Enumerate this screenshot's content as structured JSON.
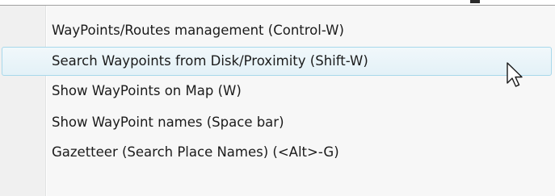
{
  "menu": {
    "items": [
      {
        "label": "WayPoints/Routes management (Control-W)"
      },
      {
        "label": "Search Waypoints from Disk/Proximity (Shift-W)"
      },
      {
        "label": "Show WayPoints on Map (W)"
      },
      {
        "label": "Show WayPoint names (Space bar)"
      },
      {
        "label": "Gazetteer (Search Place Names) (<Alt>-G)"
      }
    ],
    "highlighted_index": 1,
    "colors": {
      "background": "#f7f7f7",
      "gutter": "#f0f0f0",
      "highlight_border": "#a8d8eb",
      "highlight_fill": "#e3f1f7",
      "text": "#1b1b1b"
    }
  },
  "cursor": {
    "icon": "mouse-pointer-icon"
  }
}
